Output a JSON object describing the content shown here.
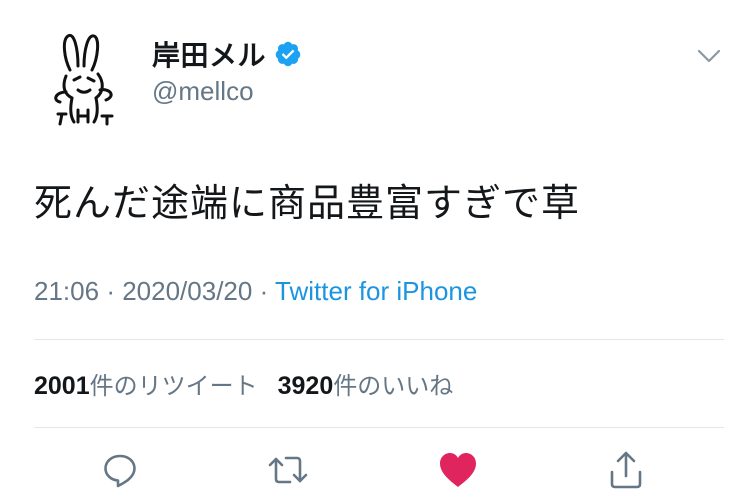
{
  "user": {
    "display_name": "岸田メル",
    "handle": "@mellco",
    "verified": true,
    "avatar_icon": "rabbit-character-drawing"
  },
  "tweet": {
    "text": "死んだ途端に商品豊富すぎで草",
    "time": "21:06",
    "separator": "·",
    "date": "2020/03/20",
    "source": "Twitter for iPhone"
  },
  "stats": {
    "retweets_count": "2001",
    "retweets_label": "件のリツイート",
    "likes_count": "3920",
    "likes_label": "件のいいね"
  },
  "actions": {
    "reply_icon": "speech-bubble-icon",
    "retweet_icon": "retweet-arrows-icon",
    "like_icon": "heart-icon",
    "share_icon": "share-icon",
    "liked": true
  },
  "colors": {
    "text": "#14171a",
    "secondary": "#657786",
    "link": "#1b95e0",
    "verified": "#1da1f2",
    "like": "#e0245e",
    "divider": "#e1e8ed"
  }
}
